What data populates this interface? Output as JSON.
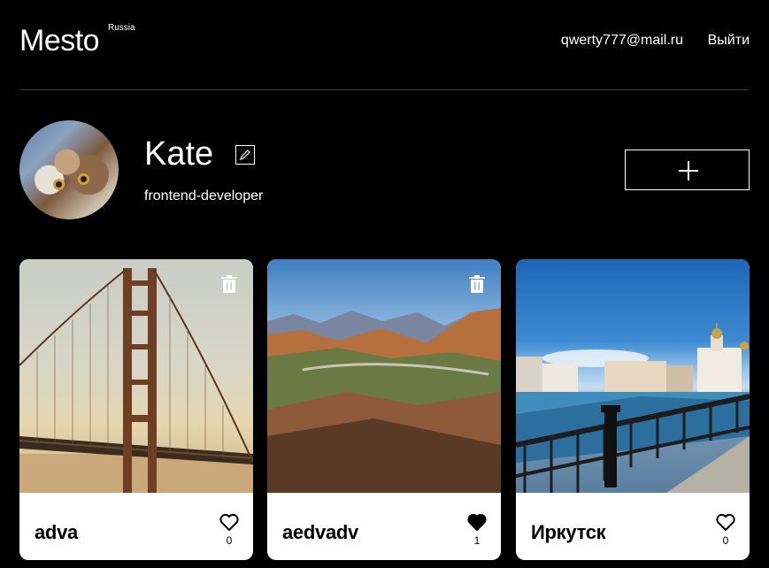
{
  "header": {
    "logo": "Mesto",
    "logo_sup": "Russia",
    "email": "qwerty777@mail.ru",
    "logout": "Выйти"
  },
  "profile": {
    "name": "Kate",
    "job": "frontend-developer",
    "edit_icon": "pencil-icon",
    "add_icon": "plus-icon"
  },
  "cards": [
    {
      "title": "adva",
      "likes": "0",
      "liked": false,
      "deletable": true
    },
    {
      "title": "aedvadv",
      "likes": "1",
      "liked": true,
      "deletable": true
    },
    {
      "title": "Иркутск",
      "likes": "0",
      "liked": false,
      "deletable": false
    }
  ],
  "colors": {
    "background": "#000000",
    "card": "#ffffff",
    "text": "#ffffff",
    "card_text": "#000000"
  }
}
